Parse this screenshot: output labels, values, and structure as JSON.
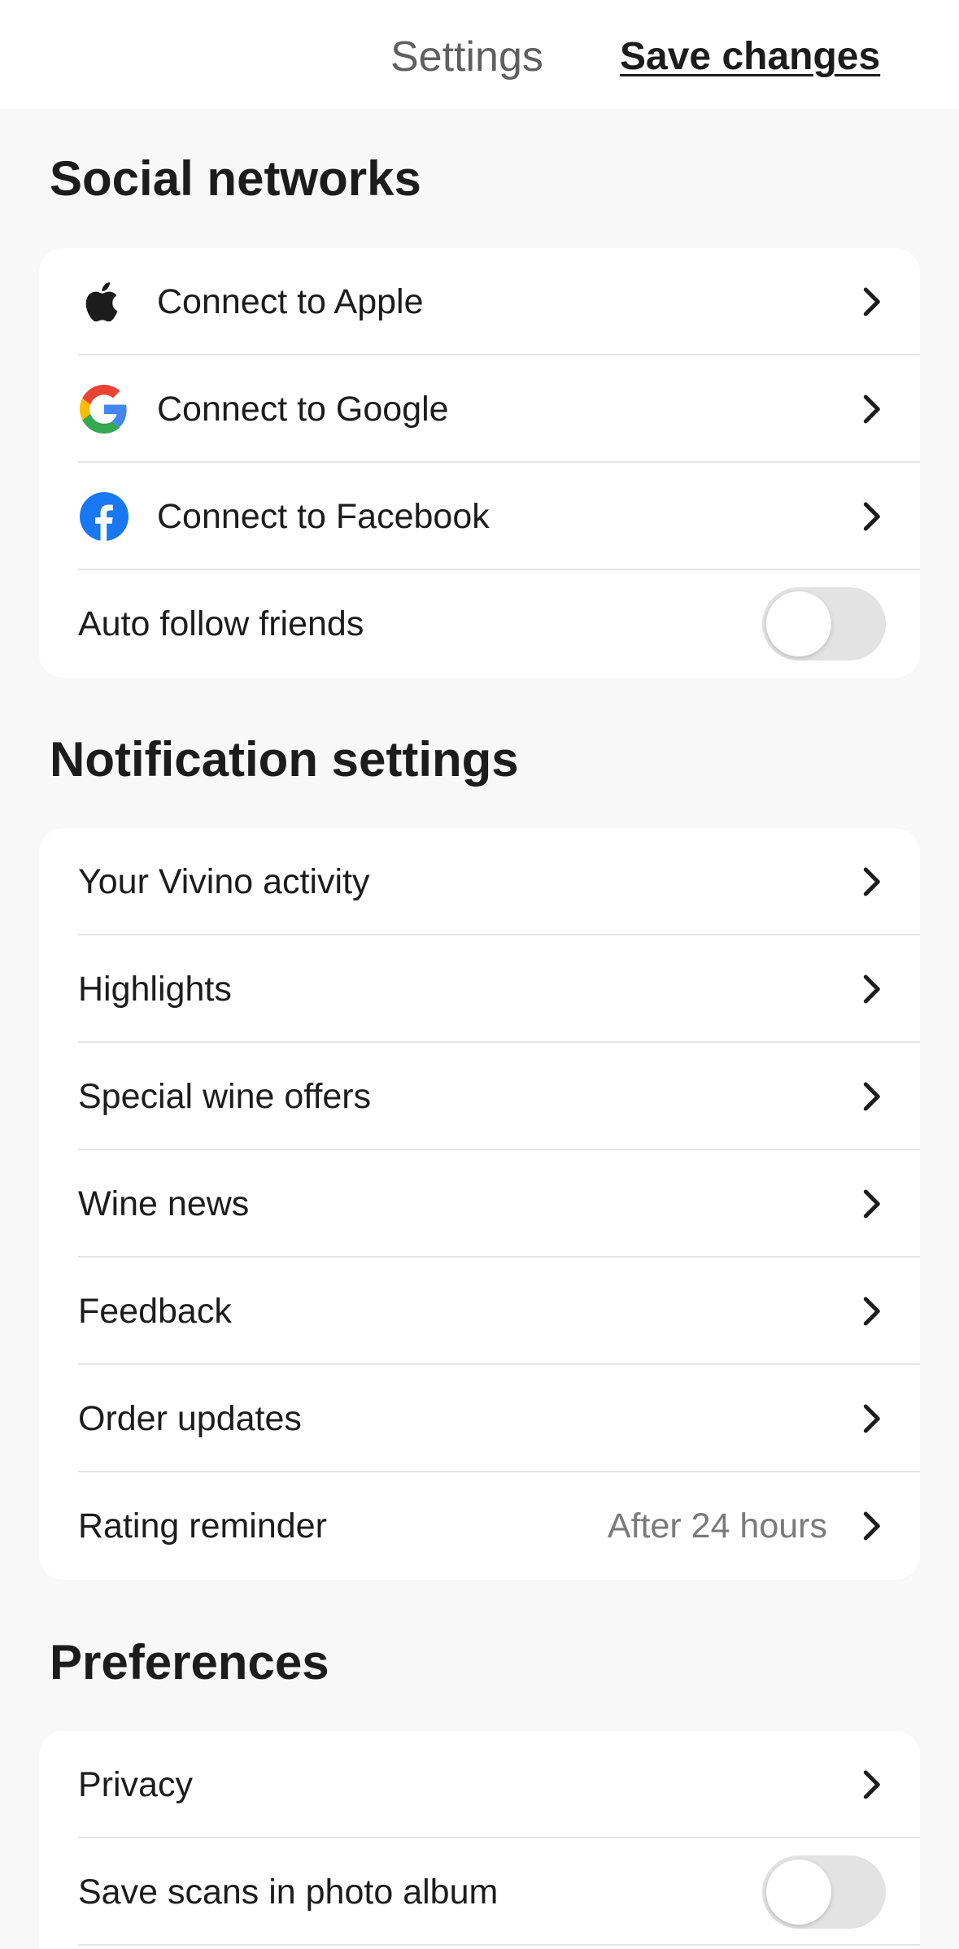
{
  "header": {
    "title": "Settings",
    "save_label": "Save changes"
  },
  "social": {
    "heading": "Social networks",
    "items": [
      {
        "label": "Connect to Apple",
        "icon": "apple-icon"
      },
      {
        "label": "Connect to Google",
        "icon": "google-icon"
      },
      {
        "label": "Connect to Facebook",
        "icon": "facebook-icon"
      }
    ],
    "auto_follow": {
      "label": "Auto follow friends",
      "enabled": false
    }
  },
  "notifications": {
    "heading": "Notification settings",
    "items": [
      {
        "label": "Your Vivino activity"
      },
      {
        "label": "Highlights"
      },
      {
        "label": "Special wine offers"
      },
      {
        "label": "Wine news"
      },
      {
        "label": "Feedback"
      },
      {
        "label": "Order updates"
      },
      {
        "label": "Rating reminder",
        "value": "After 24 hours"
      }
    ]
  },
  "preferences": {
    "heading": "Preferences",
    "items": [
      {
        "label": "Privacy"
      }
    ],
    "save_scans": {
      "label": "Save scans in photo album",
      "enabled": false
    }
  },
  "colors": {
    "facebook": "#1877f2",
    "google_blue": "#4285f4",
    "google_red": "#ea4335",
    "google_yellow": "#fbbc05",
    "google_green": "#34a853",
    "toggle_off": "#e3e3e3"
  }
}
